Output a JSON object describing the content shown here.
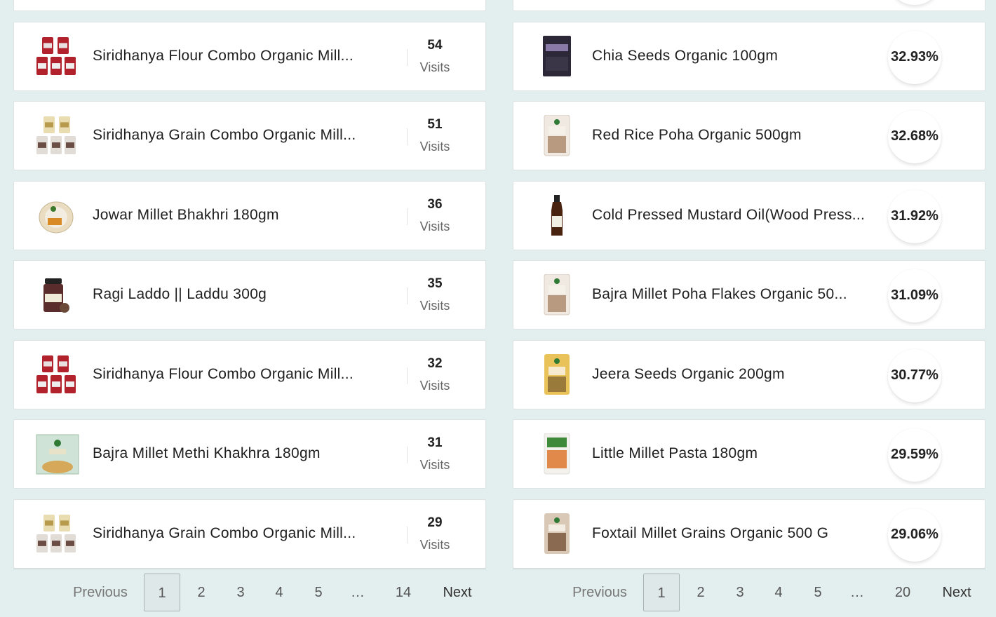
{
  "visits_panel": {
    "items": [
      {
        "name": "Siridhanya Flour Combo Organic Mill...",
        "count": "54",
        "label": "Visits",
        "thumb": "flour-combo"
      },
      {
        "name": "Siridhanya Grain Combo Organic Mill...",
        "count": "51",
        "label": "Visits",
        "thumb": "grain-combo"
      },
      {
        "name": "Jowar Millet Bhakhri 180gm",
        "count": "36",
        "label": "Visits",
        "thumb": "bhakhri"
      },
      {
        "name": "Ragi Laddo || Laddu 300g",
        "count": "35",
        "label": "Visits",
        "thumb": "jar"
      },
      {
        "name": "Siridhanya Flour Combo Organic Mill...",
        "count": "32",
        "label": "Visits",
        "thumb": "flour-combo"
      },
      {
        "name": "Bajra Millet Methi Khakhra 180gm",
        "count": "31",
        "label": "Visits",
        "thumb": "khakhra"
      },
      {
        "name": "Siridhanya Grain Combo Organic Mill...",
        "count": "29",
        "label": "Visits",
        "thumb": "grain-combo"
      }
    ],
    "pagination": {
      "previous": "Previous",
      "pages": [
        "1",
        "2",
        "3",
        "4",
        "5",
        "…",
        "14"
      ],
      "active": "1",
      "next": "Next"
    }
  },
  "percent_panel": {
    "items": [
      {
        "name": "Chia Seeds Organic 100gm",
        "percent": "32.93%",
        "thumb": "dark-pouch"
      },
      {
        "name": "Red Rice Poha Organic 500gm",
        "percent": "32.68%",
        "thumb": "clear-pouch"
      },
      {
        "name": "Cold Pressed Mustard Oil(Wood Press...",
        "percent": "31.92%",
        "thumb": "bottle"
      },
      {
        "name": "Bajra Millet Poha Flakes Organic 50...",
        "percent": "31.09%",
        "thumb": "clear-pouch"
      },
      {
        "name": "Jeera Seeds Organic 200gm",
        "percent": "30.77%",
        "thumb": "yellow-pouch"
      },
      {
        "name": "Little Millet Pasta 180gm",
        "percent": "29.59%",
        "thumb": "pasta-pouch"
      },
      {
        "name": "Foxtail Millet Grains Organic 500 G",
        "percent": "29.06%",
        "thumb": "brown-pouch"
      }
    ],
    "pagination": {
      "previous": "Previous",
      "pages": [
        "1",
        "2",
        "3",
        "4",
        "5",
        "…",
        "20"
      ],
      "active": "1",
      "next": "Next"
    }
  },
  "colors": {
    "background": "#e3eeee",
    "card": "#ffffff",
    "active_page": "#dfe8e8"
  }
}
